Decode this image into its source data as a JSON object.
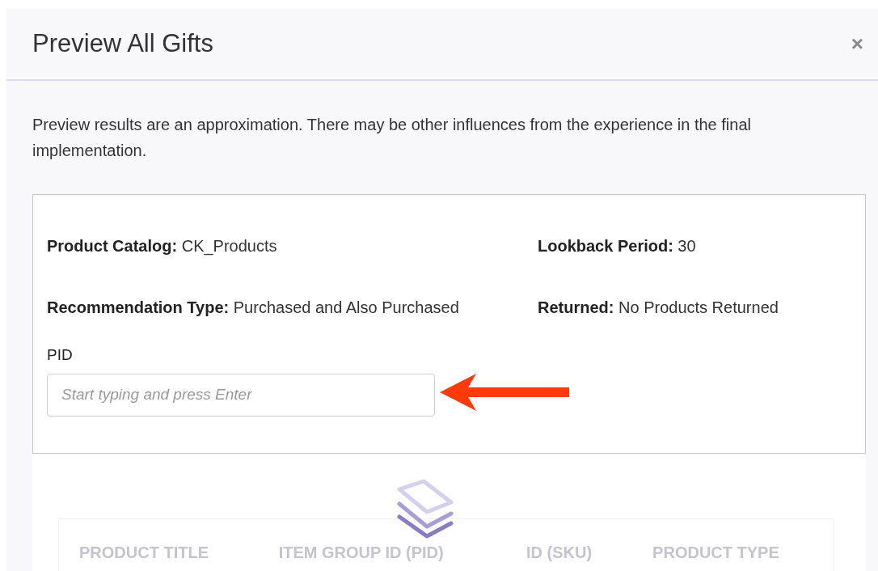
{
  "dialog": {
    "title": "Preview All Gifts",
    "close": "×"
  },
  "note": "Preview results are an approximation. There may be other influences from the experience in the final implementation.",
  "details": [
    {
      "label": "Product Catalog:",
      "value": "CK_Products"
    },
    {
      "label": "Lookback Period:",
      "value": "30"
    },
    {
      "label": "Recommendation Type:",
      "value": "Purchased and Also Purchased"
    },
    {
      "label": "Returned:",
      "value": "No Products Returned"
    }
  ],
  "pid_field": {
    "label": "PID",
    "placeholder": "Start typing and press Enter"
  },
  "results": {
    "loading": true,
    "columns": [
      "PRODUCT TITLE",
      "ITEM GROUP ID (PID)",
      "ID (SKU)",
      "PRODUCT TYPE"
    ]
  }
}
